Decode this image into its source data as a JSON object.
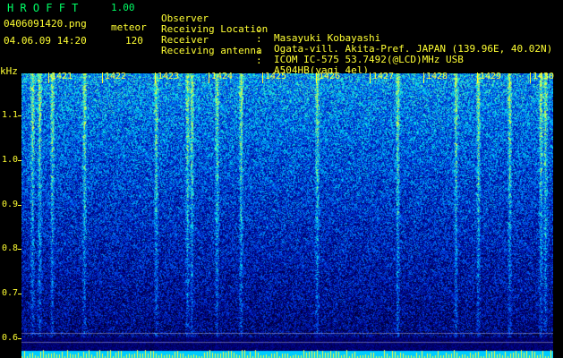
{
  "header": {
    "app_title": "HROFFT",
    "app_version": "1.00",
    "filename": "0406091420.png",
    "mode_label": "meteor",
    "timestamp": "04.06.09 14:20",
    "count": "120"
  },
  "metadata": [
    {
      "key": "Observer",
      "value": "Masayuki Kobayashi"
    },
    {
      "key": "Receiving Location",
      "value": "Ogata-vill. Akita-Pref. JAPAN (139.96E, 40.02N)"
    },
    {
      "key": "Receiver",
      "value": "ICOM IC-575 53.7492(@LCD)MHz USB"
    },
    {
      "key": "Receiving antenna",
      "value": "A504HB(yagi 4el)"
    }
  ],
  "spectrogram": {
    "freq_unit": "kHz",
    "freq_ticks": [
      "1.1",
      "1.0",
      "0.9",
      "0.8",
      "0.7",
      "0.6"
    ],
    "time_labels": [
      "1421",
      "1422",
      "1423",
      "1424",
      "1425",
      "1426",
      "1427",
      "1428",
      "1429",
      "1430"
    ],
    "colors": {
      "background": "#000000",
      "low": "#000a66",
      "mid": "#0044cc",
      "high": "#00ccff",
      "peak": "#ffff33",
      "text": "#ffff33",
      "title": "#00ff66"
    }
  }
}
